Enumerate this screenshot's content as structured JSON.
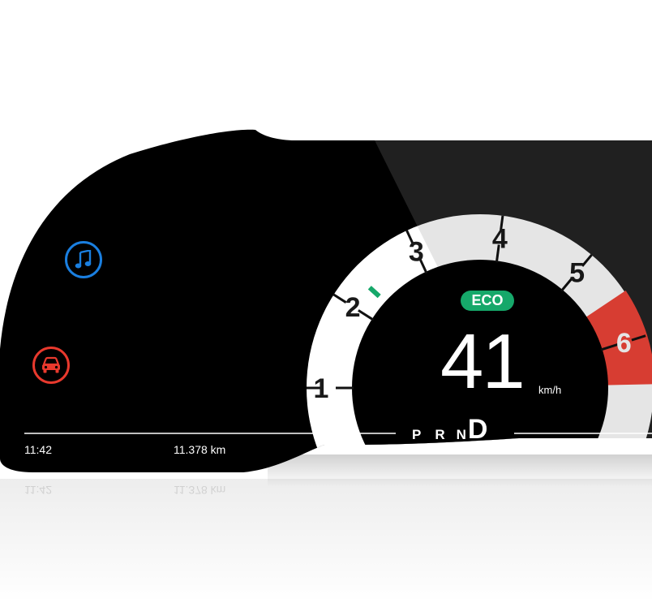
{
  "colors": {
    "background": "#ffffff",
    "panel": "#000000",
    "dial_face": "#ffffff",
    "redline": "#f04438",
    "eco_badge": "#16a86a",
    "needle": "#16a86a",
    "music_icon": "#1a7fe0",
    "car_icon": "#e8392d",
    "text": "#ffffff"
  },
  "icons": {
    "music": "music-note-icon",
    "vehicle": "car-icon"
  },
  "status_bar": {
    "clock": "11:42",
    "odometer": "11.378 km"
  },
  "gear_selector": {
    "gears": [
      "P",
      "R",
      "N",
      "D"
    ],
    "active": "D"
  },
  "speed": {
    "value": "41",
    "unit": "km/h"
  },
  "eco_badge": "ECO",
  "tachometer": {
    "labels": [
      "1",
      "2",
      "3",
      "4",
      "5",
      "6"
    ],
    "needle_value": 2.3,
    "redline_start": 5.5
  }
}
